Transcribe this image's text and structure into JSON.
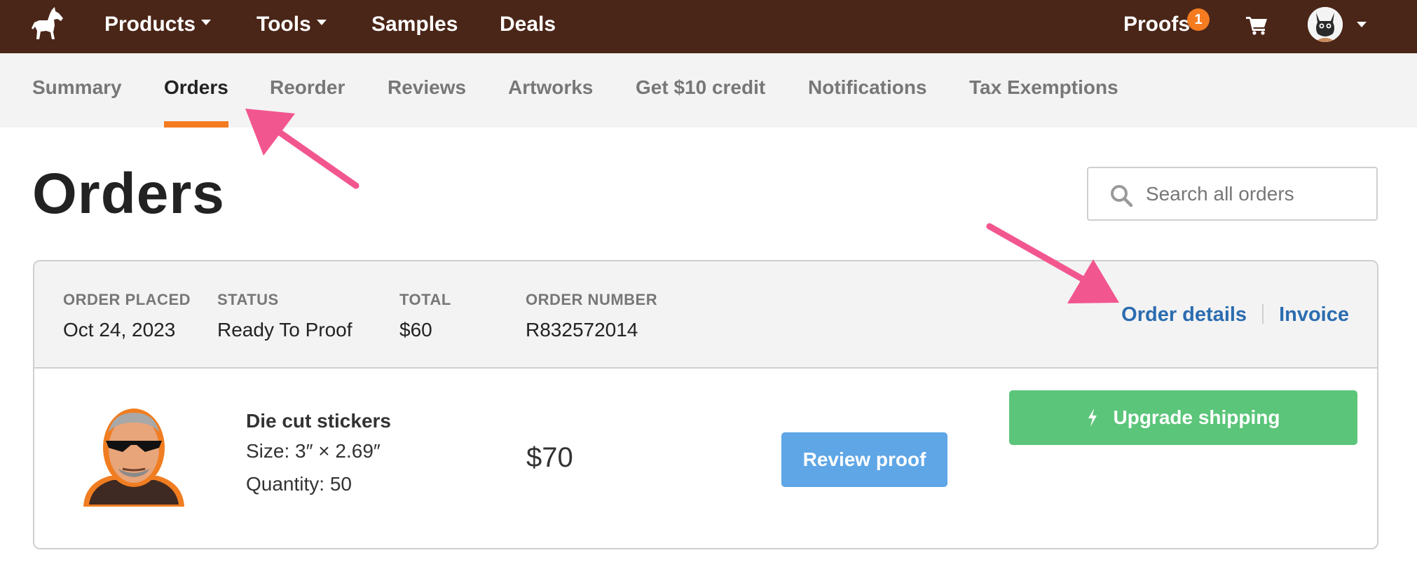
{
  "topnav": {
    "products": "Products",
    "tools": "Tools",
    "samples": "Samples",
    "deals": "Deals",
    "proofs": "Proofs",
    "proofs_count": "1"
  },
  "tabs": [
    {
      "label": "Summary",
      "active": false
    },
    {
      "label": "Orders",
      "active": true
    },
    {
      "label": "Reorder",
      "active": false
    },
    {
      "label": "Reviews",
      "active": false
    },
    {
      "label": "Artworks",
      "active": false
    },
    {
      "label": "Get $10 credit",
      "active": false
    },
    {
      "label": "Notifications",
      "active": false
    },
    {
      "label": "Tax Exemptions",
      "active": false
    }
  ],
  "page": {
    "title": "Orders",
    "search_placeholder": "Search all orders"
  },
  "order": {
    "placed_label": "ORDER PLACED",
    "placed_value": "Oct 24, 2023",
    "status_label": "STATUS",
    "status_value": "Ready To Proof",
    "total_label": "TOTAL",
    "total_value": "$60",
    "number_label": "ORDER NUMBER",
    "number_value": "R832572014",
    "details_link": "Order details",
    "invoice_link": "Invoice",
    "item": {
      "name": "Die cut stickers",
      "size": "Size: 3″ × 2.69″",
      "quantity": "Quantity: 50",
      "price": "$70"
    },
    "review_button": "Review proof",
    "upgrade_button": "Upgrade shipping"
  },
  "icons": {
    "logo": "horse-logo-icon",
    "cart": "cart-icon",
    "search": "search-icon",
    "bolt": "lightning-bolt-icon",
    "avatar": "cat-avatar"
  },
  "colors": {
    "topbar": "#4a2618",
    "accent": "#f47b20",
    "link": "#2b6cb0",
    "review_button": "#5ea6e6",
    "upgrade_button": "#5bc57a",
    "annotation_arrow": "#f2568f"
  }
}
